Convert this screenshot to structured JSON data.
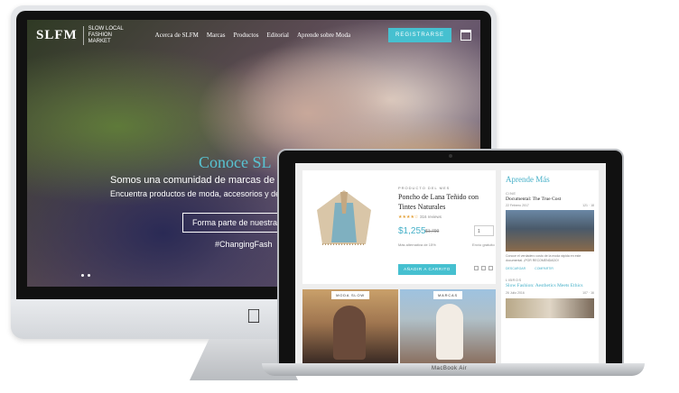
{
  "imac_site": {
    "logo": "SLFM",
    "logo_tagline": "SLOW LOCAL FASHION MARKET",
    "nav": [
      "Acerca de SLFM",
      "Marcas",
      "Productos",
      "Editorial",
      "Aprende sobre Moda"
    ],
    "register_button": "REGISTRARSE",
    "hero_title": "Conoce SL",
    "hero_subtitle": "Somos una comunidad de marcas de",
    "hero_subtitle2": "Encuentra productos de moda, accesorios y deco",
    "cta": "Forma parte de nuestra",
    "hashtag": "#ChangingFash"
  },
  "macbook_site": {
    "product": {
      "kicker": "PRODUCTO DEL MES",
      "name": "Poncho de Lana Teñido con Tintes Naturales",
      "stars": "★★★★☆",
      "reviews": "316 reviews",
      "price": "$1,255",
      "old_price": "$1,799",
      "quantity": "1",
      "stock_note": "Más alternativa de 15%",
      "shipping": "Envío gratuito",
      "add_to_cart": "AÑADIR A CARRITO"
    },
    "tiles": [
      {
        "tag": "MODA SLOW"
      },
      {
        "tag": "MARCAS"
      }
    ],
    "sidebar": {
      "title": "Aprende Más",
      "item1_category": "CINE",
      "item1_title": "Documental: The True Cost",
      "item1_date": "22 Febrero 2017",
      "item1_counts": "121 · 18",
      "item1_text": "Conoce el verdadero costo de la moda rápida en este documental. ¡POR RECOMENDADO!",
      "item1_action1": "DESCARGAR",
      "item1_action2": "COMPARTIR",
      "item2_category": "LIBROS",
      "item2_title": "Slow Fashion: Aesthetics Meets Ethics",
      "item2_date": "26 Julio 2016",
      "item2_counts": "107 · 16"
    }
  },
  "device_labels": {
    "macbook": "MacBook Air"
  },
  "colors": {
    "accent": "#46c0d0",
    "price": "#46b0c8"
  }
}
